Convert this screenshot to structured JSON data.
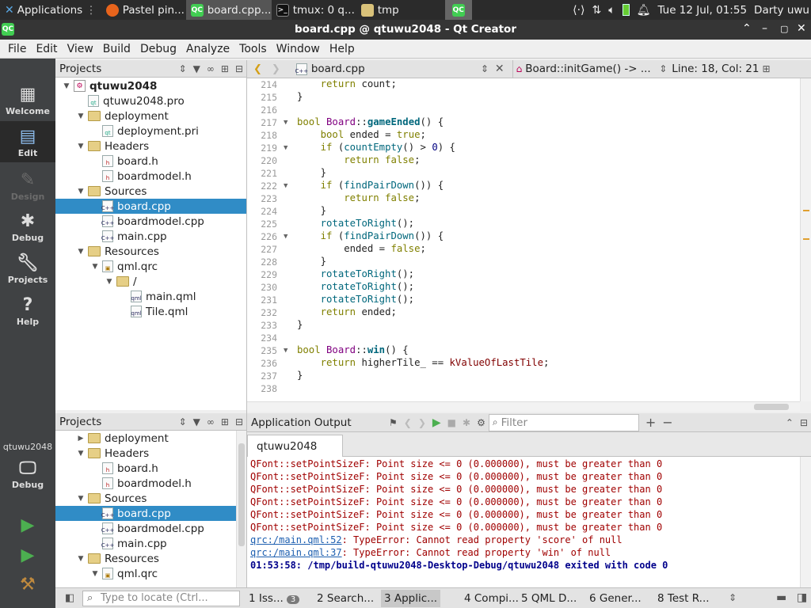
{
  "taskbar": {
    "apps_label": "Applications",
    "tasks": [
      "Pastel pin...",
      "board.cpp...",
      "tmux: 0 q...",
      "tmp"
    ],
    "qt_badge": "QC",
    "clock": "Tue 12 Jul, 01:55",
    "user": "Darty uwu"
  },
  "window": {
    "title": "board.cpp @ qtuwu2048 - Qt Creator"
  },
  "menu": [
    "File",
    "Edit",
    "View",
    "Build",
    "Debug",
    "Analyze",
    "Tools",
    "Window",
    "Help"
  ],
  "modes": [
    {
      "label": "Welcome",
      "icon": "grid-icon"
    },
    {
      "label": "Edit",
      "icon": "edit-icon"
    },
    {
      "label": "Design",
      "icon": "pen-icon"
    },
    {
      "label": "Debug",
      "icon": "bug-icon"
    },
    {
      "label": "Projects",
      "icon": "wrench-icon"
    },
    {
      "label": "Help",
      "icon": "help-icon"
    }
  ],
  "kit": {
    "project": "qtuwu2048",
    "mode": "Debug"
  },
  "projects_panel": {
    "title": "Projects",
    "tree": [
      {
        "label": "qtuwu2048",
        "depth": 0,
        "type": "project",
        "expanded": true,
        "bold": true
      },
      {
        "label": "qtuwu2048.pro",
        "depth": 1,
        "type": "file"
      },
      {
        "label": "deployment",
        "depth": 1,
        "type": "folder",
        "expanded": true
      },
      {
        "label": "deployment.pri",
        "depth": 2,
        "type": "file"
      },
      {
        "label": "Headers",
        "depth": 1,
        "type": "folder",
        "expanded": true
      },
      {
        "label": "board.h",
        "depth": 2,
        "type": "file"
      },
      {
        "label": "boardmodel.h",
        "depth": 2,
        "type": "file"
      },
      {
        "label": "Sources",
        "depth": 1,
        "type": "folder",
        "expanded": true
      },
      {
        "label": "board.cpp",
        "depth": 2,
        "type": "file",
        "selected": true
      },
      {
        "label": "boardmodel.cpp",
        "depth": 2,
        "type": "file"
      },
      {
        "label": "main.cpp",
        "depth": 2,
        "type": "file"
      },
      {
        "label": "Resources",
        "depth": 1,
        "type": "folder",
        "expanded": true
      },
      {
        "label": "qml.qrc",
        "depth": 2,
        "type": "file",
        "expanded": true
      },
      {
        "label": "/",
        "depth": 3,
        "type": "folder",
        "expanded": true
      },
      {
        "label": "main.qml",
        "depth": 4,
        "type": "file"
      },
      {
        "label": "Tile.qml",
        "depth": 4,
        "type": "file"
      }
    ]
  },
  "projects_panel2": {
    "title": "Projects",
    "tree": [
      {
        "label": "deployment",
        "depth": 1,
        "type": "folder",
        "expanded": false
      },
      {
        "label": "Headers",
        "depth": 1,
        "type": "folder",
        "expanded": true
      },
      {
        "label": "board.h",
        "depth": 2,
        "type": "file"
      },
      {
        "label": "boardmodel.h",
        "depth": 2,
        "type": "file"
      },
      {
        "label": "Sources",
        "depth": 1,
        "type": "folder",
        "expanded": true
      },
      {
        "label": "board.cpp",
        "depth": 2,
        "type": "file",
        "selected": true
      },
      {
        "label": "boardmodel.cpp",
        "depth": 2,
        "type": "file"
      },
      {
        "label": "main.cpp",
        "depth": 2,
        "type": "file"
      },
      {
        "label": "Resources",
        "depth": 1,
        "type": "folder",
        "expanded": true
      },
      {
        "label": "qml.qrc",
        "depth": 2,
        "type": "file",
        "expanded": true
      }
    ]
  },
  "editor": {
    "filename": "board.cpp",
    "symbol": "Board::initGame() -> ...",
    "position": "Line: 18, Col: 21",
    "first_line": 214,
    "lines": [
      "    return count;",
      "}",
      "",
      "bool Board::gameEnded() {",
      "    bool ended = true;",
      "    if (countEmpty() > 0) {",
      "        return false;",
      "    }",
      "    if (findPairDown()) {",
      "        return false;",
      "    }",
      "    rotateToRight();",
      "    if (findPairDown()) {",
      "        ended = false;",
      "    }",
      "    rotateToRight();",
      "    rotateToRight();",
      "    rotateToRight();",
      "    return ended;",
      "}",
      "",
      "bool Board::win() {",
      "    return higherTile_ == kValueOfLastTile;",
      "}",
      ""
    ],
    "fold_lines": [
      217,
      219,
      222,
      226,
      235
    ]
  },
  "output": {
    "title": "Application Output",
    "filter_placeholder": "Filter",
    "tab": "qtuwu2048",
    "lines": [
      {
        "kind": "warn",
        "text": "QFont::setPointSizeF: Point size <= 0 (0.000000), must be greater than 0"
      },
      {
        "kind": "warn",
        "text": "QFont::setPointSizeF: Point size <= 0 (0.000000), must be greater than 0"
      },
      {
        "kind": "warn",
        "text": "QFont::setPointSizeF: Point size <= 0 (0.000000), must be greater than 0"
      },
      {
        "kind": "warn",
        "text": "QFont::setPointSizeF: Point size <= 0 (0.000000), must be greater than 0"
      },
      {
        "kind": "warn",
        "text": "QFont::setPointSizeF: Point size <= 0 (0.000000), must be greater than 0"
      },
      {
        "kind": "warn",
        "text": "QFont::setPointSizeF: Point size <= 0 (0.000000), must be greater than 0"
      },
      {
        "kind": "link",
        "link": "qrc:/main.qml:52",
        "text": ": TypeError: Cannot read property 'score' of null"
      },
      {
        "kind": "link",
        "link": "qrc:/main.qml:37",
        "text": ": TypeError: Cannot read property 'win' of null"
      },
      {
        "kind": "fin",
        "text": "01:53:58: /tmp/build-qtuwu2048-Desktop-Debug/qtuwu2048 exited with code 0"
      }
    ]
  },
  "statusbar": {
    "locate_placeholder": "Type to locate (Ctrl...",
    "tabs": [
      {
        "label": "1 Iss...",
        "badge": "3"
      },
      {
        "label": "2 Search..."
      },
      {
        "label": "3 Applic...",
        "selected": true
      },
      {
        "label": "4 Compi..."
      },
      {
        "label": "5 QML D..."
      },
      {
        "label": "6 Gener..."
      },
      {
        "label": "8 Test R..."
      }
    ]
  }
}
